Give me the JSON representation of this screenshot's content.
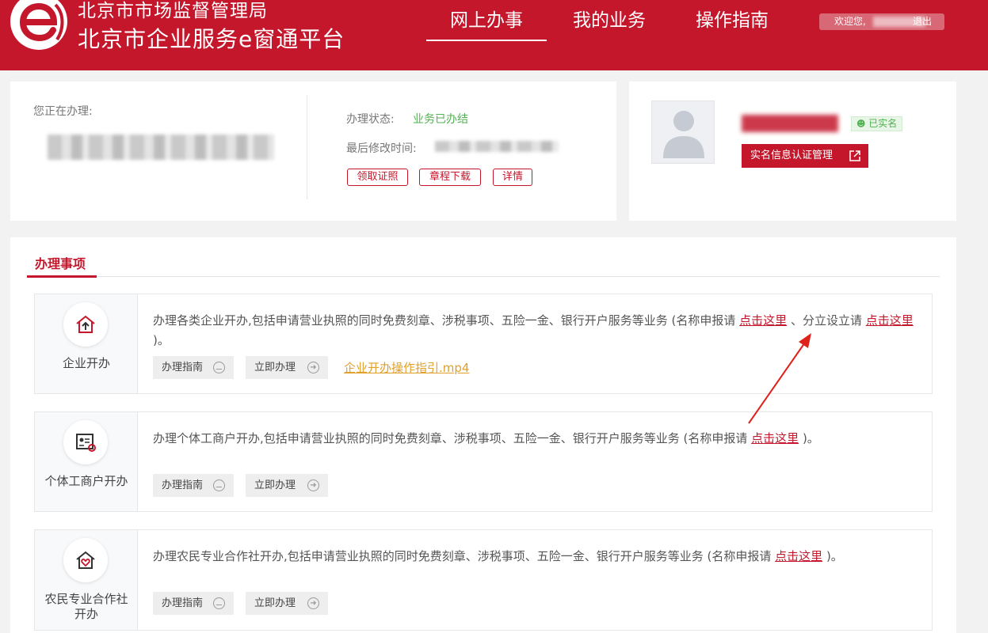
{
  "colors": {
    "brand": "#c4172c",
    "status_ok": "#52b152",
    "video_link": "#e0a02a"
  },
  "header": {
    "org": "北京市市场监督管理局",
    "platform": "北京市企业服务e窗通平台",
    "nav": [
      "网上办事",
      "我的业务",
      "操作指南"
    ],
    "welcome": "欢迎您,",
    "logout": "退出"
  },
  "current": {
    "label": "您正在办理:",
    "status_label": "办理状态:",
    "status_value": "业务已办结",
    "modified_label": "最后修改时间:",
    "buttons": [
      "领取证照",
      "章程下载",
      "详情"
    ]
  },
  "user": {
    "verified_badge": "已实名",
    "auth_button": "实名信息认证管理"
  },
  "section": {
    "title": "办理事项",
    "guide_label": "办理指南",
    "apply_label": "立即办理",
    "items": [
      {
        "name": "企业开办",
        "desc_pre": "办理各类企业开办,包括申请营业执照的同时免费刻章、涉税事项、五险一金、银行开户服务等业务 (名称申报请 ",
        "link1": "点击这里",
        "desc_mid": " 、分立设立请 ",
        "link2": "点击这里",
        "desc_post": " )。",
        "video": "企业开办操作指引.mp4"
      },
      {
        "name": "个体工商户开办",
        "desc_pre": "办理个体工商户开办,包括申请营业执照的同时免费刻章、涉税事项、五险一金、银行开户服务等业务 (名称申报请 ",
        "link1": "点击这里",
        "desc_post": " )。"
      },
      {
        "name": "农民专业合作社开办",
        "desc_pre": "办理农民专业合作社开办,包括申请营业执照的同时免费刻章、涉税事项、五险一金、银行开户服务等业务 (名称申报请 ",
        "link1": "点击这里",
        "desc_post": " )。"
      }
    ]
  }
}
